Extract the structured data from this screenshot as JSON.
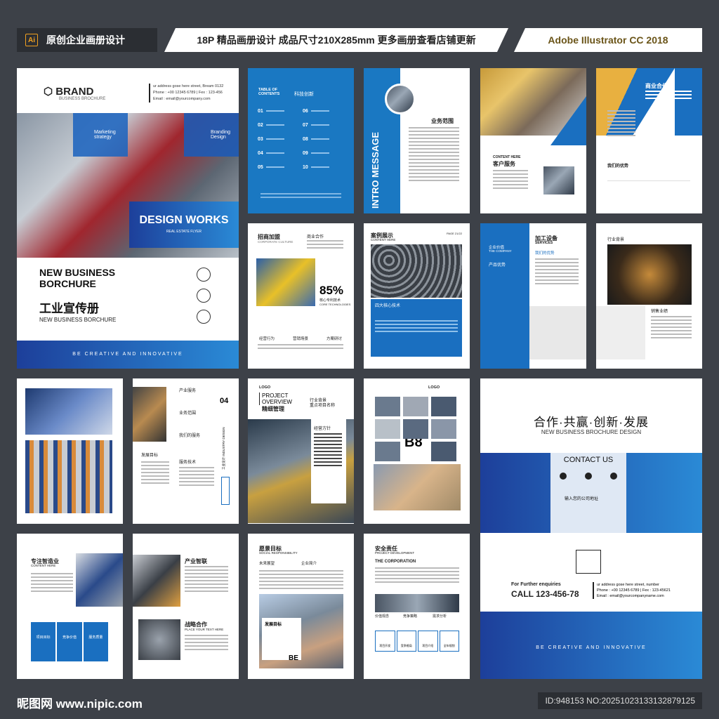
{
  "header": {
    "ai_badge": "Ai",
    "left_title": "原创企业画册设计",
    "center_title": "18P 精品画册设计 成品尺寸210X285mm 更多画册查看店铺更新",
    "right_title": "Adobe Illustrator CC 2018"
  },
  "cover": {
    "brand": "BRAND",
    "brand_sub": "BUSINESS BROCHURE",
    "address": "ur address gose here street, Bream 0132",
    "phone": "Phone : +00 12345 6789 | Fex : 123-456",
    "email": "Email : email@yourcompany.com",
    "tile1": "Marketing strategy",
    "tile2": "Branding Design",
    "design_works": "DESIGN WORKS",
    "design_sub": "REAL ESTATE FLYER",
    "title_en": "NEW BUSINESS BORCHURE",
    "title_cn": "工业宣传册",
    "title_en2": "NEW BUSINESS BORCHURE",
    "footer": "BE CREATIVE AND INNOVATIVE"
  },
  "toc": {
    "heading": "TABLE OF CONTENTS",
    "heading_cn": "科技创新",
    "items": [
      "01",
      "02",
      "03",
      "04",
      "05",
      "06",
      "07",
      "08",
      "09",
      "10"
    ]
  },
  "intro": {
    "vertical": "INTRO MESSAGE",
    "title_cn": "业务范围"
  },
  "p4": {
    "label_en": "CONTENT HERE",
    "label_cn": "客户服务"
  },
  "p5": {
    "title_cn": "商业合作",
    "sub_cn": "我们的优势"
  },
  "p6": {
    "title_cn": "招商加盟",
    "sub": "CORPORATE CULTURE",
    "side": "商业合作",
    "percent": "85%",
    "percent_cn": "核心专利技术",
    "percent_en": "CORE TECHNOLOGIES",
    "icon1": "经营行为",
    "icon2": "营销场景",
    "icon3": "方案研讨"
  },
  "p7": {
    "title_cn": "案例展示",
    "sub": "CONTENT HERE",
    "page": "PAGE 21/22",
    "band_cn": "四大核心技术"
  },
  "p8": {
    "left_cn": "企业价值",
    "left_en": "THE COMPANY",
    "left_cn2": "产品优势",
    "title_cn": "加工设备",
    "title_en": "SERVICES",
    "sub_cn": "我们的优势"
  },
  "p9": {
    "title_cn": "行业背景",
    "sub_cn": "销售业绩"
  },
  "p11": {
    "t1": "产业服务",
    "t2": "业务范围",
    "t3": "我们的服务",
    "t4": "发展目标",
    "t5": "服务技术",
    "num": "04",
    "vert": "工业设计 INDUSTRY DESIGN"
  },
  "p12": {
    "logo": "LOGO",
    "title_en": "PROJECT OVERVIEW",
    "title_cn": "精细管理",
    "side_cn": "行业背景",
    "side_cn2": "重点项目名称",
    "box_cn": "经营方针"
  },
  "p13": {
    "logo": "LOGO",
    "big": "B8"
  },
  "p14": {
    "slogan": "合作·共赢·创新·发展",
    "slogan_en": "NEW BUSINESS  BROCHURE DESIGN",
    "contact": "CONTACT US",
    "addr_cn": "输入您的公司地址",
    "further": "For Further enquiries",
    "call": "CALL 123-456-78",
    "address": "ur address gose here street, number",
    "phone": "Phone : +00 12345 6789 | Fex : 123-45621",
    "email": "Email : email@yourcompanyname.com",
    "footer": "BE CREATIVE AND INNOVATIVE"
  },
  "p15": {
    "title_cn": "专注智造业",
    "sub": "CONTENT HERE",
    "b1": "项目目标",
    "b2": "竞争价值",
    "b3": "服务质量"
  },
  "p16": {
    "title_cn": "产业智联",
    "title2_cn": "战略合作",
    "title2_en": "PLACE YOUR TEXT HERE"
  },
  "p17": {
    "title_cn": "愿景目标",
    "sub": "SOCIAL RESPONSIBILITY",
    "c1": "未来展望",
    "c2": "企业简介",
    "box_cn": "发展目标",
    "big": "BE"
  },
  "p18": {
    "title_cn": "安全责任",
    "sub": "PROJECT DEVELOPMENT",
    "corp": "THE CORPORATION",
    "l1": "价值观念",
    "l2": "竞争策略",
    "l3": "需求分析",
    "i1": "项目开发",
    "i2": "竞争格局",
    "i3": "项目介绍",
    "i4": "全年规划"
  },
  "footer": {
    "site": "昵图网 www.nipic.com",
    "id": "ID:948153 NO:20251023133132879125"
  }
}
